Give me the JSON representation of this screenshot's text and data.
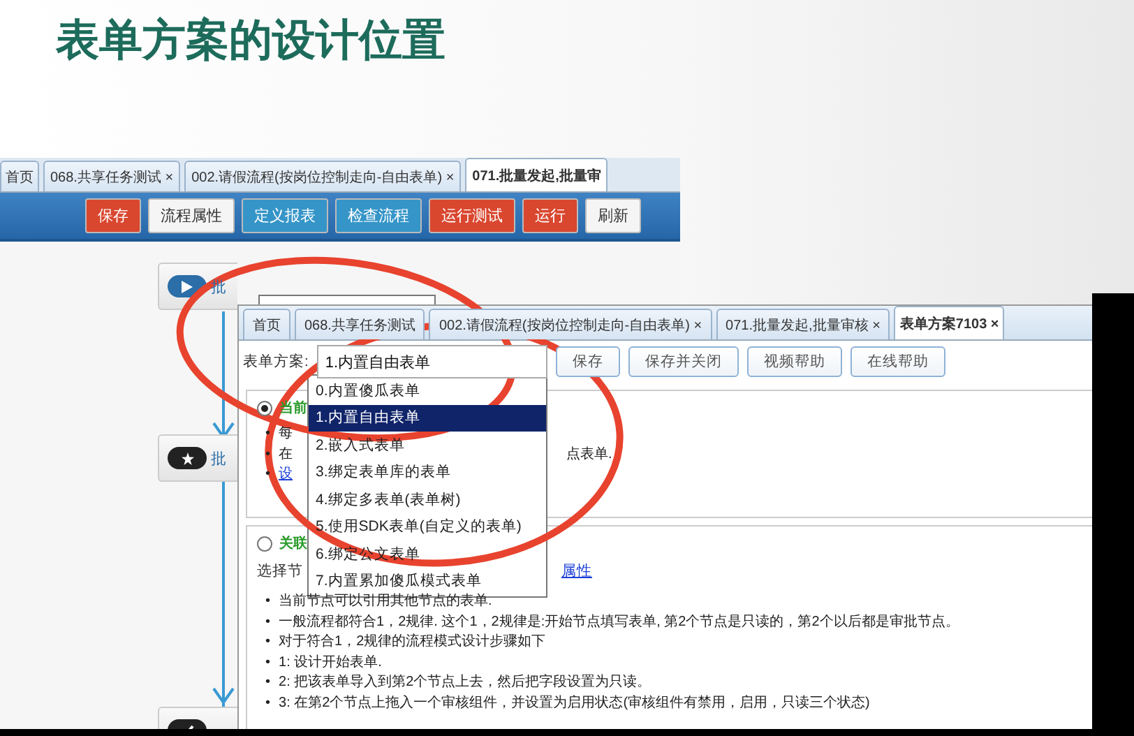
{
  "slide": {
    "title": "表单方案的设计位置"
  },
  "back_window": {
    "tabs": [
      {
        "label": "首页",
        "selected": false
      },
      {
        "label": "068.共享任务测试 ×",
        "selected": false
      },
      {
        "label": "002.请假流程(按岗位控制走向-自由表单) ×",
        "selected": false
      },
      {
        "label": "071.批量发起,批量审",
        "selected": true
      }
    ],
    "toolbar": [
      {
        "label": "保存",
        "kind": "danger"
      },
      {
        "label": "流程属性",
        "kind": "plain"
      },
      {
        "label": "定义报表",
        "kind": "primary"
      },
      {
        "label": "检查流程",
        "kind": "primary"
      },
      {
        "label": "运行测试",
        "kind": "danger"
      },
      {
        "label": "运行",
        "kind": "danger"
      },
      {
        "label": "刷新",
        "kind": "plain"
      }
    ],
    "nodes": [
      {
        "kind": "start",
        "label": "批"
      },
      {
        "kind": "star",
        "label": "批"
      },
      {
        "kind": "check"
      }
    ]
  },
  "front_window": {
    "tabs": [
      {
        "label": "首页",
        "selected": false
      },
      {
        "label": "068.共享任务测试",
        "selected": false
      },
      {
        "label": "002.请假流程(按岗位控制走向-自由表单) ×",
        "selected": false
      },
      {
        "label": "071.批量发起,批量审核 ×",
        "selected": false
      },
      {
        "label": "表单方案7103 ×",
        "selected": true
      }
    ],
    "scheme_label": "表单方案:",
    "scheme_value": "1.内置自由表单",
    "buttons": [
      "保存",
      "保存并关闭",
      "视频帮助",
      "在线帮助"
    ],
    "dropdown": [
      {
        "label": "0.内置傻瓜表单",
        "selected": false
      },
      {
        "label": "1.内置自由表单",
        "selected": true
      },
      {
        "label": "2.嵌入式表单",
        "selected": false
      },
      {
        "label": "3.绑定表单库的表单",
        "selected": false
      },
      {
        "label": "4.绑定多表单(表单树)",
        "selected": false
      },
      {
        "label": "5.使用SDK表单(自定义的表单)",
        "selected": false
      },
      {
        "label": "6.绑定公文表单",
        "selected": false
      },
      {
        "label": "7.内置累加傻瓜模式表单",
        "selected": false
      }
    ],
    "sections": [
      {
        "selected": true,
        "title": "当前",
        "marker": "•",
        "bullets": [
          {
            "text": "每"
          },
          {
            "text": "在",
            "tail": "点表单."
          },
          {
            "text": "设",
            "kind": "link"
          }
        ]
      },
      {
        "selected": false,
        "title": "关联",
        "marker": "•",
        "intro": "选择节",
        "intro_link": "属性",
        "bullets": [
          {
            "text": "当前节点可以引用其他节点的表单."
          },
          {
            "text": "一般流程都符合1，2规律. 这个1，2规律是:开始节点填写表单, 第2个节点是只读的，第2个以后都是审批节点。"
          },
          {
            "text": "对于符合1，2规律的流程模式设计步骤如下"
          },
          {
            "text": "1: 设计开始表单."
          },
          {
            "text": "2: 把该表单导入到第2个节点上去，然后把字段设置为只读。"
          },
          {
            "text": "3: 在第2个节点上拖入一个审核组件，并设置为启用状态(审核组件有禁用，启用，只读三个状态)"
          }
        ]
      }
    ]
  }
}
